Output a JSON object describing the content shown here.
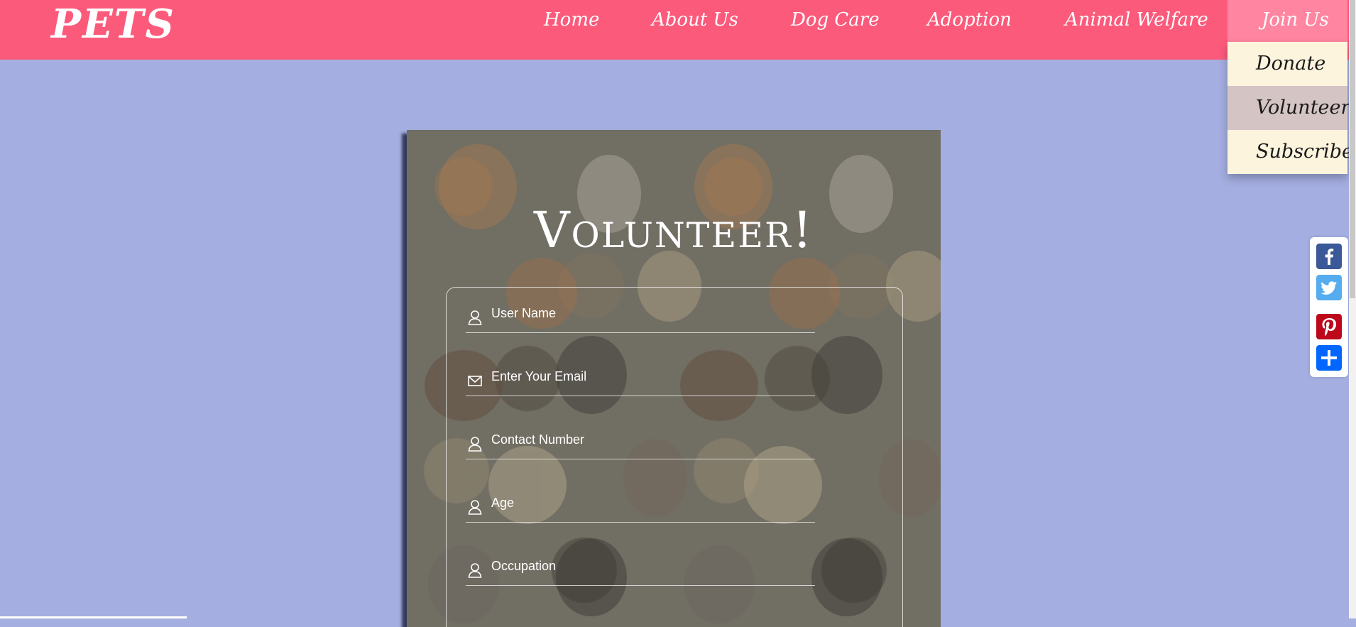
{
  "header": {
    "logo": "PETS",
    "nav": [
      "Home",
      "About Us",
      "Dog Care",
      "Adoption",
      "Animal Welfare",
      "Join Us"
    ],
    "background_color": "#fb5a7b",
    "active_tab_color": "#ff85a0"
  },
  "dropdown": {
    "items": [
      "Donate",
      "Volunteer",
      "Subscribe"
    ],
    "selected": "Volunteer",
    "background_color": "#fcf4dd",
    "hover_color": "#d4c4c4"
  },
  "form": {
    "title": "Volunteer!",
    "fields": [
      {
        "label": "User Name",
        "icon": "user-icon"
      },
      {
        "label": "Enter Your Email",
        "icon": "envelope-icon"
      },
      {
        "label": "Contact Number",
        "icon": "user-icon"
      },
      {
        "label": "Age",
        "icon": "user-icon"
      },
      {
        "label": "Occupation",
        "icon": "user-icon"
      }
    ]
  },
  "share": {
    "buttons": [
      {
        "icon": "facebook-icon",
        "color": "#3b5998"
      },
      {
        "icon": "twitter-icon",
        "color": "#55acee"
      },
      {
        "icon": "pinterest-icon",
        "color": "#bd081c"
      },
      {
        "icon": "add-share-icon",
        "color": "#0166ff"
      }
    ]
  },
  "page": {
    "background_color": "#a4aee0"
  }
}
